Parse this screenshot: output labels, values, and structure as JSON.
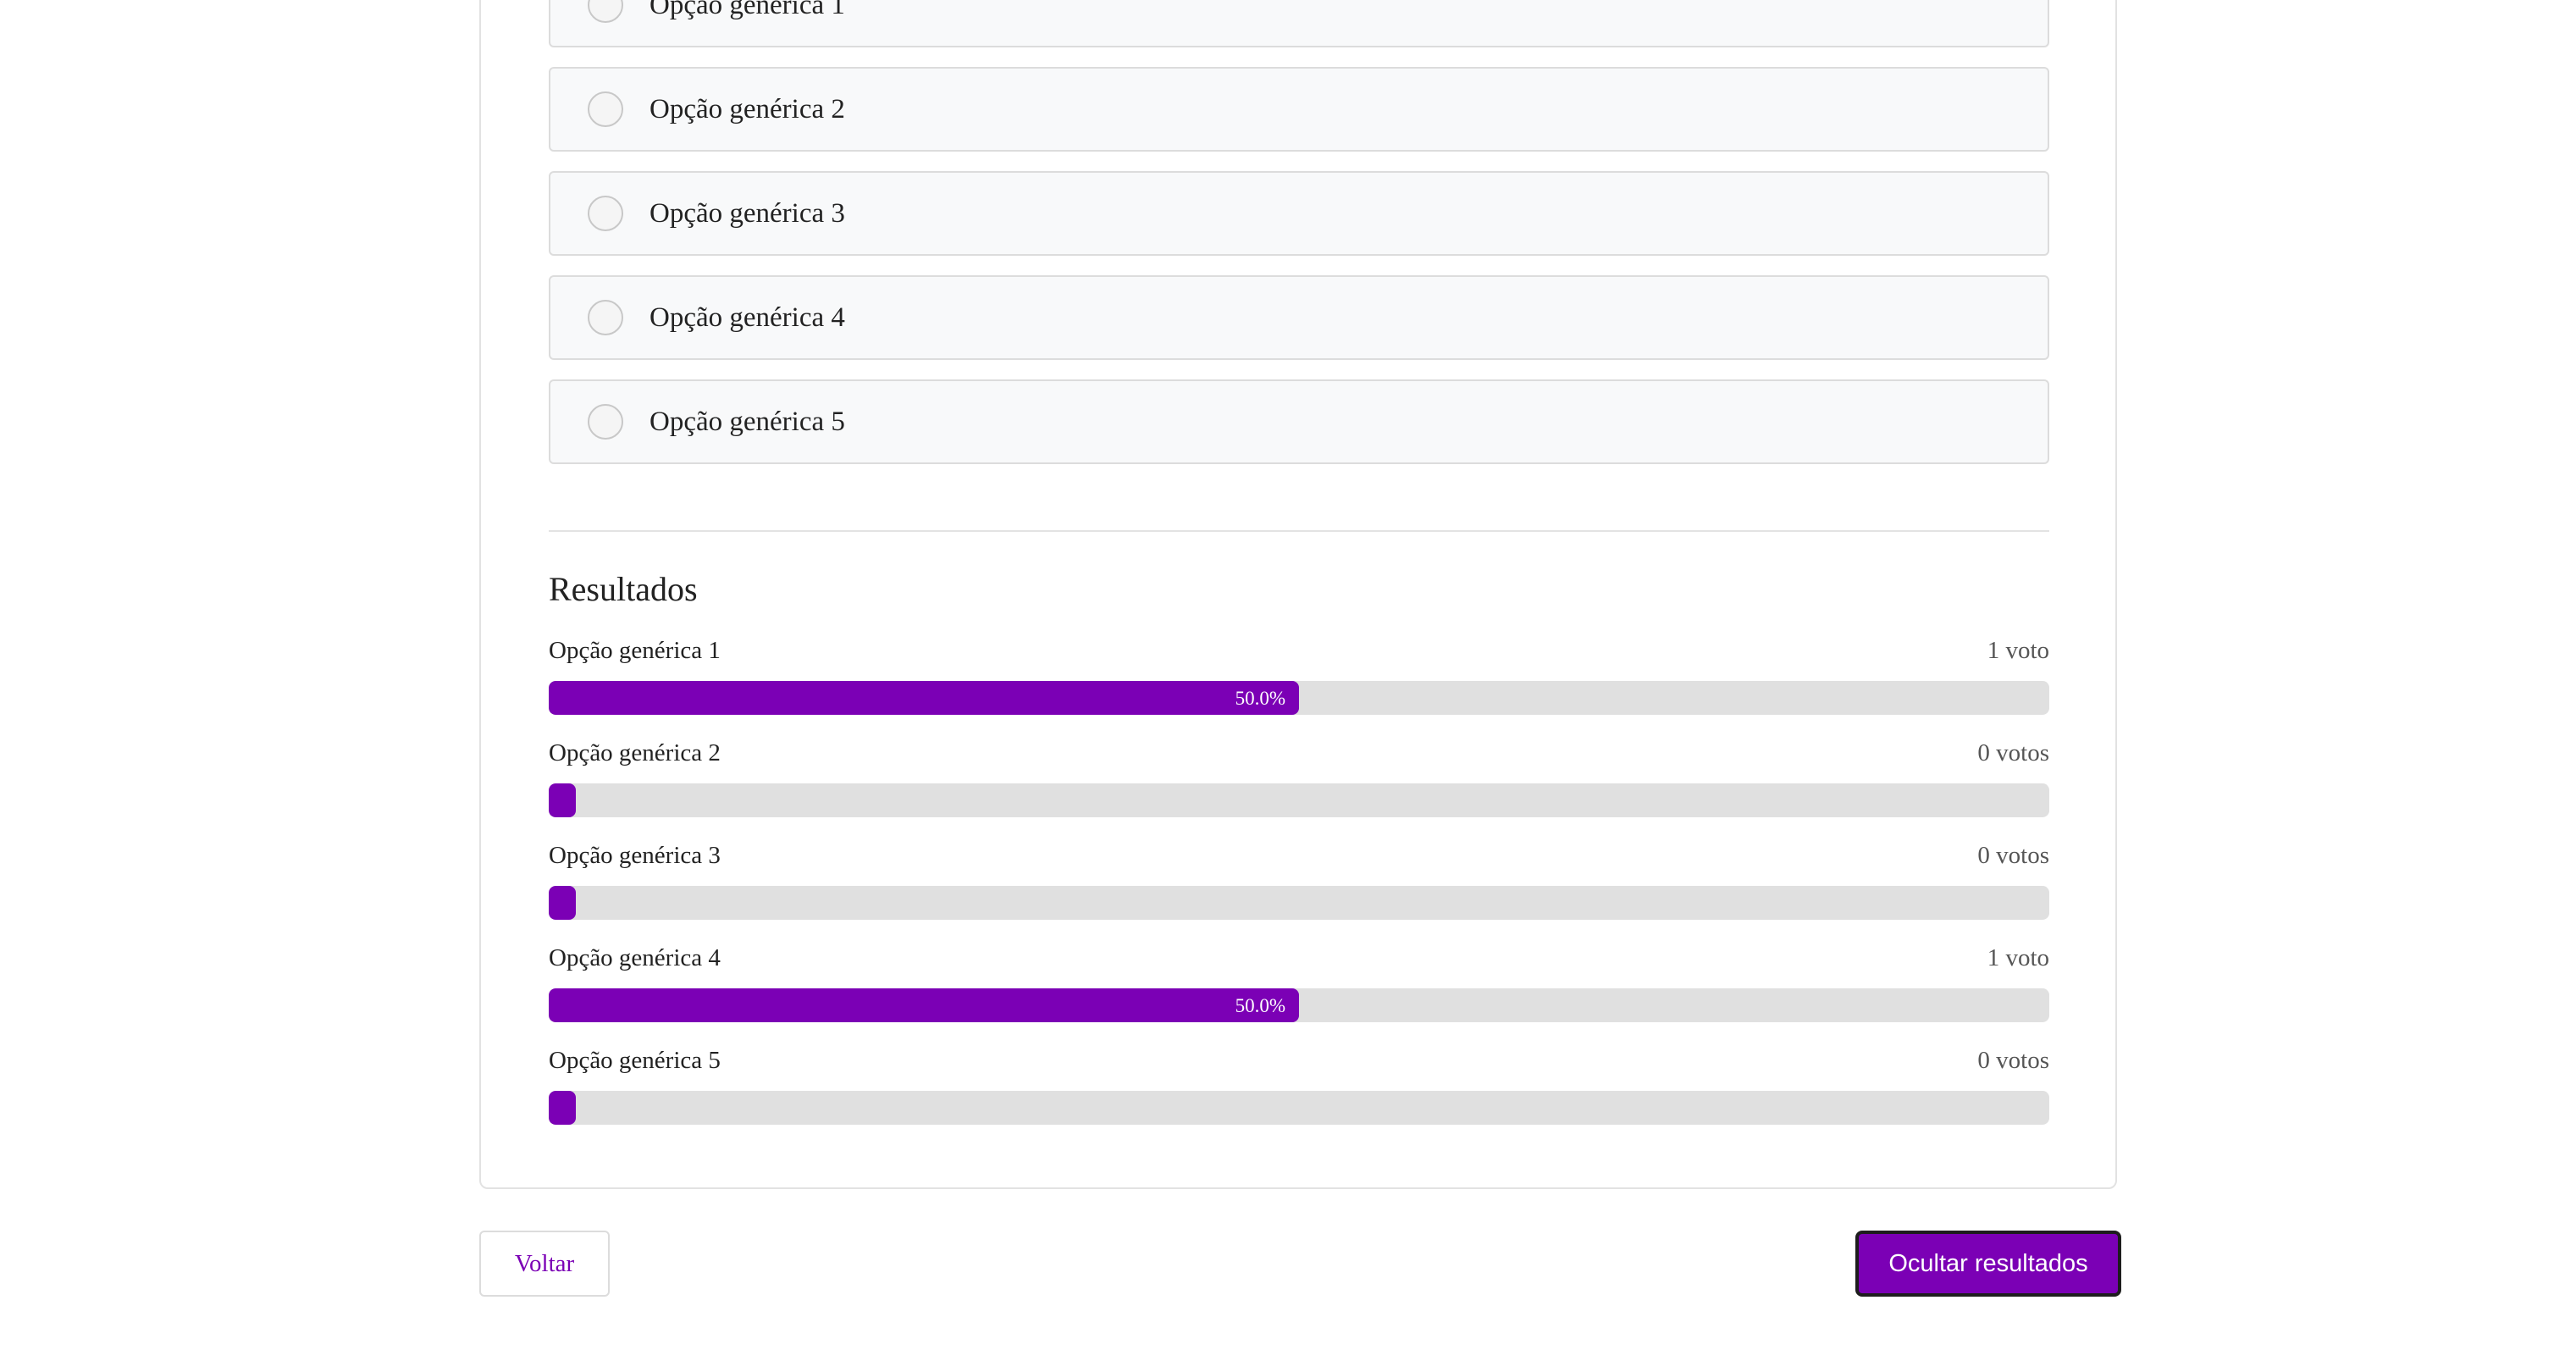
{
  "poll": {
    "options": [
      {
        "label": "Opção genérica 1"
      },
      {
        "label": "Opção genérica 2"
      },
      {
        "label": "Opção genérica 3"
      },
      {
        "label": "Opção genérica 4"
      },
      {
        "label": "Opção genérica 5"
      }
    ]
  },
  "results": {
    "title": "Resultados",
    "rows": [
      {
        "label": "Opção genérica 1",
        "votes": "1 voto",
        "percent": 50.0,
        "percent_label": "50.0%"
      },
      {
        "label": "Opção genérica 2",
        "votes": "0 votos",
        "percent": 0,
        "percent_label": ""
      },
      {
        "label": "Opção genérica 3",
        "votes": "0 votos",
        "percent": 0,
        "percent_label": ""
      },
      {
        "label": "Opção genérica 4",
        "votes": "1 voto",
        "percent": 50.0,
        "percent_label": "50.0%"
      },
      {
        "label": "Opção genérica 5",
        "votes": "0 votos",
        "percent": 0,
        "percent_label": ""
      }
    ]
  },
  "actions": {
    "back_label": "Voltar",
    "hide_results_label": "Ocultar resultados"
  },
  "colors": {
    "accent": "#7b00b5",
    "track": "#e0e0e0"
  }
}
